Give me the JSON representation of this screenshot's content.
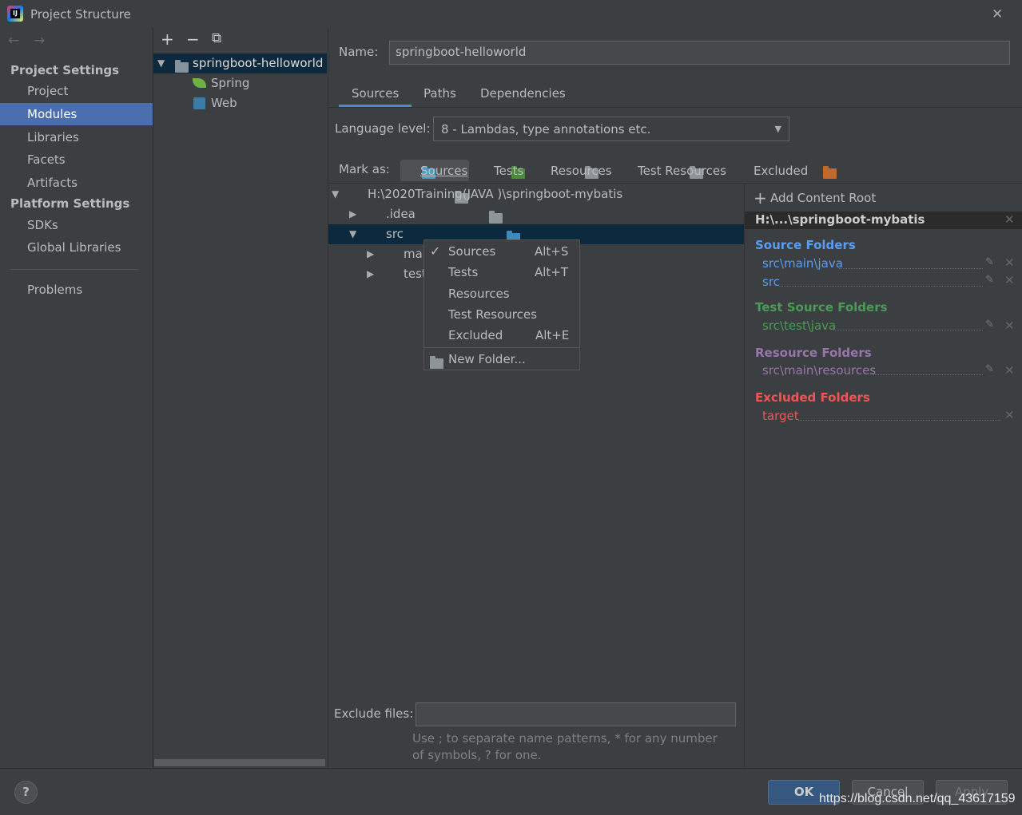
{
  "window": {
    "title": "Project Structure",
    "close": "✕"
  },
  "nav": {
    "back": "←",
    "forward": "→"
  },
  "sidebar": {
    "project_settings": "Project Settings",
    "items1": [
      "Project",
      "Modules",
      "Libraries",
      "Facets",
      "Artifacts"
    ],
    "platform_settings": "Platform Settings",
    "items2": [
      "SDKs",
      "Global Libraries"
    ],
    "problems": "Problems",
    "selected": "Modules"
  },
  "module_tree": {
    "toolbar": {
      "add": "+",
      "remove": "−",
      "copy": "⧉"
    },
    "root": "springboot-helloworld",
    "children": [
      "Spring",
      "Web"
    ]
  },
  "main": {
    "name_label": "Name:",
    "name_value": "springboot-helloworld",
    "tabs": [
      "Sources",
      "Paths",
      "Dependencies"
    ],
    "active_tab": "Sources",
    "language_label": "Language level:",
    "language_value": "8 - Lambdas, type annotations etc.",
    "mark_as_label": "Mark as:",
    "mark_as": [
      "Sources",
      "Tests",
      "Resources",
      "Test Resources",
      "Excluded"
    ],
    "tree": {
      "root": "H:\\2020Training(JAVA )\\springboot-mybatis",
      "idea": ".idea",
      "src": "src",
      "main": "main",
      "test": "test"
    },
    "context_menu": [
      {
        "label": "Sources",
        "shortcut": "Alt+S",
        "checked": true
      },
      {
        "label": "Tests",
        "shortcut": "Alt+T"
      },
      {
        "label": "Resources",
        "shortcut": ""
      },
      {
        "label": "Test Resources",
        "shortcut": ""
      },
      {
        "label": "Excluded",
        "shortcut": "Alt+E"
      },
      {
        "label": "New Folder...",
        "shortcut": ""
      }
    ],
    "exclude_label": "Exclude files:",
    "exclude_value": "",
    "hint": "Use ; to separate name patterns, * for any number of symbols, ? for one."
  },
  "right": {
    "add_root": "Add Content Root",
    "root": "H:\\...\\springboot-mybatis",
    "source_title": "Source Folders",
    "source": [
      "src\\main\\java",
      "src"
    ],
    "test_title": "Test Source Folders",
    "test": [
      "src\\test\\java"
    ],
    "resource_title": "Resource Folders",
    "resource": [
      "src\\main\\resources"
    ],
    "excluded_title": "Excluded Folders",
    "excluded": [
      "target"
    ]
  },
  "colors": {
    "source": "#589df6",
    "test": "#499c54",
    "resource": "#9876aa",
    "excluded": "#f05555",
    "selected": "#4b6eaf",
    "tree_selected": "#0d293e"
  },
  "footer": {
    "help": "?",
    "ok": "OK",
    "cancel": "Cancel",
    "apply": "Apply",
    "watermark": "https://blog.csdn.net/qq_43617159"
  }
}
